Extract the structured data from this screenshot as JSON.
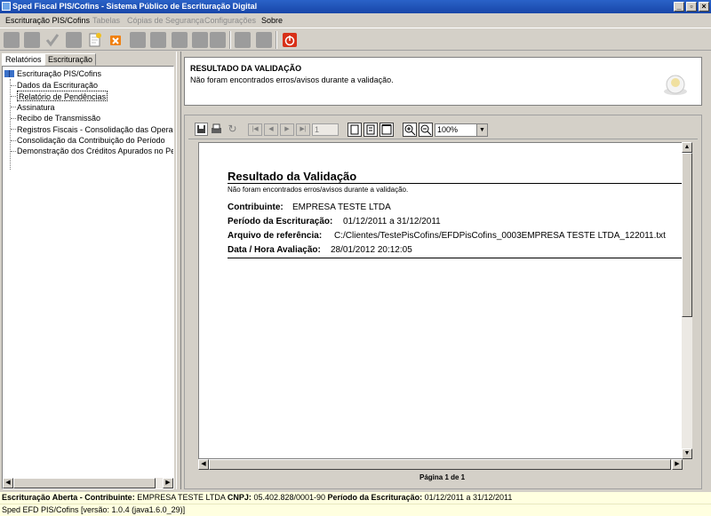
{
  "window": {
    "title": "Sped Fiscal PIS/Cofins - Sistema Público de Escrituração Digital"
  },
  "menu": [
    {
      "label": "Escrituração PIS/Cofins",
      "enabled": true
    },
    {
      "label": "Tabelas",
      "enabled": false
    },
    {
      "label": "Cópias de Segurança",
      "enabled": false
    },
    {
      "label": "Configurações",
      "enabled": false
    },
    {
      "label": "Sobre",
      "enabled": true
    }
  ],
  "left_tabs": [
    "Relatórios",
    "Escrituração"
  ],
  "tree": {
    "root": "Escrituração PIS/Cofins",
    "items": [
      "Dados da Escrituração",
      "Relatório de Pendências",
      "Assinatura",
      "Recibo de Transmissão",
      "Registros Fiscais - Consolidação das Operaçõ",
      "Consolidação da Contribuição do Período",
      "Demonstração dos Créditos Apurados no Perío"
    ],
    "selected_index": 1
  },
  "validation": {
    "title": "RESULTADO DA VALIDAÇÃO",
    "message": "Não foram encontrados erros/avisos durante a validação."
  },
  "viewer": {
    "page_input": "1",
    "zoom": "100%",
    "page_status": "Página 1 de 1"
  },
  "report": {
    "title": "Resultado da Validação",
    "subtitle": "Não foram encontrados erros/avisos durante a validação.",
    "contribuinte_label": "Contribuinte:",
    "contribuinte_value": "EMPRESA TESTE LTDA",
    "periodo_label": "Período da Escrituração:",
    "periodo_value": "01/12/2011 a 31/12/2011",
    "arquivo_label": "Arquivo de referência:",
    "arquivo_value": "C:/Clientes/TestePisCofins/EFDPisCofins_0003EMPRESA TESTE LTDA_122011.txt",
    "data_label": "Data / Hora Avaliação:",
    "data_value": "28/01/2012 20:12:05"
  },
  "status": {
    "l1_a": "Escrituração Aberta - Contribuinte:",
    "l1_b": "EMPRESA TESTE LTDA",
    "l1_c": "CNPJ:",
    "l1_d": "05.402.828/0001-90",
    "l1_e": "Período da Escrituração:",
    "l1_f": "01/12/2011 a 31/12/2011",
    "l2": "Sped EFD PIS/Cofins [versão: 1.0.4 (java1.6.0_29)]"
  }
}
